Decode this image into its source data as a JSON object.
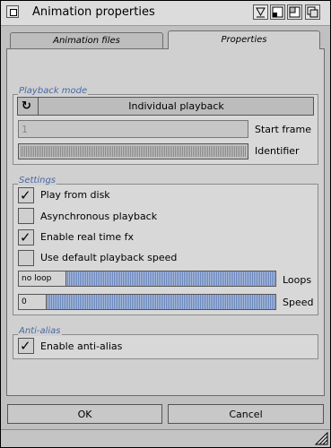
{
  "window": {
    "title": "Animation properties"
  },
  "tabs": [
    {
      "label": "Animation files",
      "active": false
    },
    {
      "label": "Properties",
      "active": true
    }
  ],
  "playback_mode": {
    "group_title": "Playback mode",
    "cycle_value": "Individual playback",
    "start_frame_value": "1",
    "start_frame_label": "Start frame",
    "identifier_label": "Identifier"
  },
  "settings": {
    "group_title": "Settings",
    "checkboxes": [
      {
        "label": "Play from disk",
        "checked": true
      },
      {
        "label": "Asynchronous playback",
        "checked": false
      },
      {
        "label": "Enable real time fx",
        "checked": true
      },
      {
        "label": "Use default playback speed",
        "checked": false
      }
    ],
    "loops": {
      "value_text": "no loop",
      "label": "Loops"
    },
    "speed": {
      "value_text": "0",
      "label": "Speed"
    }
  },
  "anti_alias": {
    "group_title": "Anti-alias",
    "checkbox": {
      "label": "Enable anti-alias",
      "checked": true
    }
  },
  "buttons": {
    "ok": "OK",
    "cancel": "Cancel"
  },
  "icons": {
    "close": "close-icon",
    "iconify": "iconify-icon",
    "snapshot": "snapshot-icon",
    "zoom": "zoom-icon",
    "depth": "depth-icon",
    "cycle": "cycle-icon",
    "check": "check-icon",
    "resize": "resize-icon"
  },
  "colors": {
    "group_title": "#4a68a8",
    "slider_fill": "#8aa0c8"
  }
}
